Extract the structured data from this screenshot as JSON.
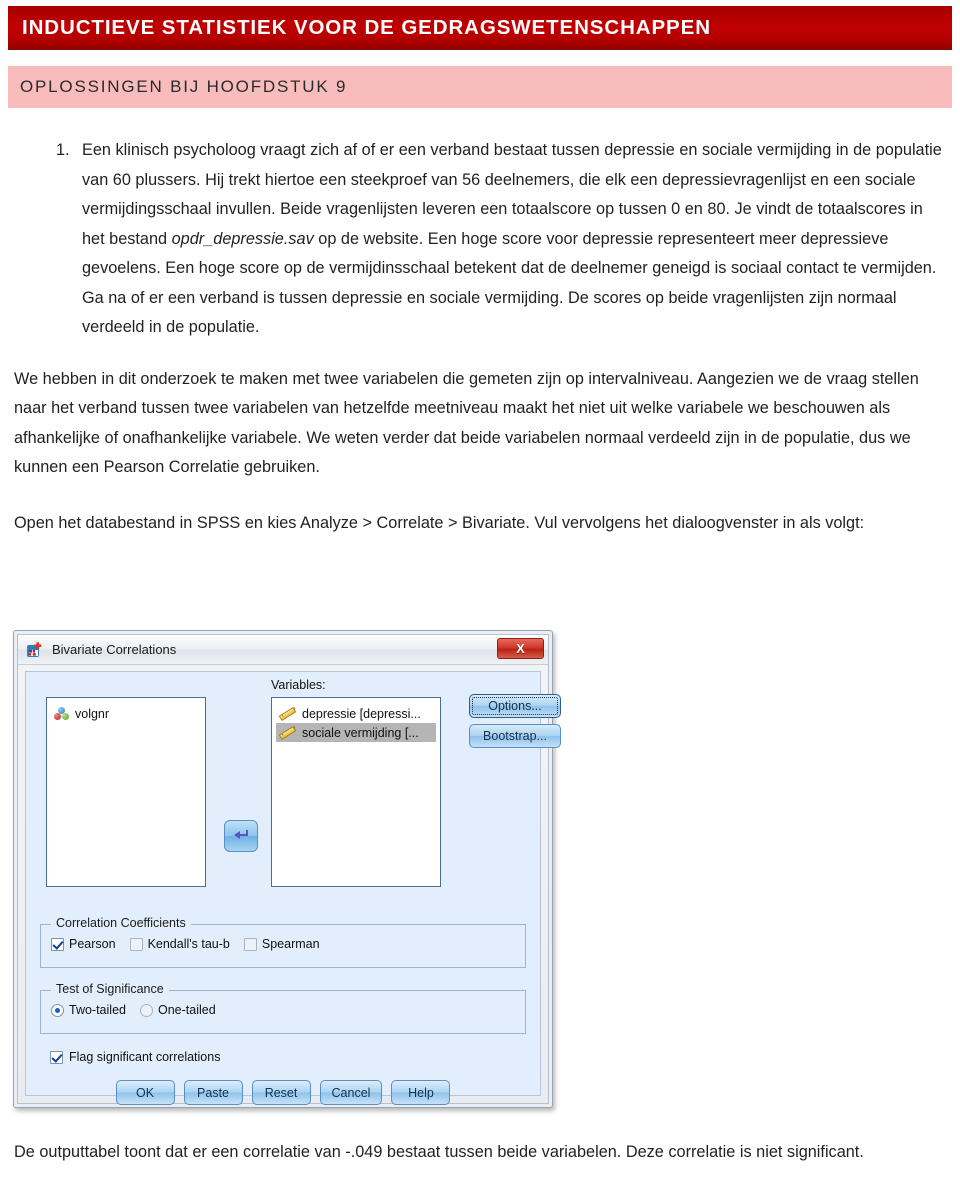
{
  "header": {
    "title": "INDUCTIEVE STATISTIEK VOOR DE GEDRAGSWETENSCHAPPEN",
    "subtitle": "OPLOSSINGEN BIJ HOOFDSTUK 9",
    "title_bg": "#b50000",
    "title_color": "#ffffff",
    "subtitle_bg": "#f9bcbc",
    "subtitle_color": "#2b2b2b"
  },
  "content": {
    "item_number": "1.",
    "paragraph_1a": "Een klinisch psycholoog vraagt zich af of er een verband bestaat tussen depressie en sociale vermijding in de populatie van 60 plussers. Hij trekt hiertoe een steekproef van 56 deelnemers, die elk een depressievragenlijst en een sociale vermijdingsschaal invullen. Beide vragenlijsten leveren een totaalscore op tussen 0 en 80. Je vindt de totaalscores in het bestand ",
    "filename": "opdr_depressie.sav",
    "paragraph_1b": " op de website. Een hoge score voor depressie representeert meer depressieve gevoelens. Een hoge score op de vermijdinsschaal betekent dat de deelnemer geneigd is sociaal contact te vermijden.",
    "paragraph_1c": "Ga na of er een verband is tussen depressie en sociale vermijding. De scores op beide vragenlijsten zijn normaal verdeeld in de populatie.",
    "paragraph_2": "We hebben in dit onderzoek te maken met twee variabelen die gemeten zijn op intervalniveau. Aangezien we de vraag stellen naar het verband tussen twee variabelen van hetzelfde meetniveau maakt het niet uit welke variabele we beschouwen als afhankelijke of onafhankelijke variabele. We weten verder dat beide variabelen normaal verdeeld zijn in de populatie, dus we kunnen een Pearson Correlatie gebruiken.",
    "paragraph_3": "Open het databestand in SPSS en kies Analyze > Correlate > Bivariate. Vul vervolgens het dialoogvenster in als volgt:",
    "paragraph_4": "De outputtabel toont dat er  een correlatie van -.049 bestaat tussen beide variabelen. Deze correlatie is niet significant."
  },
  "dialog": {
    "title": "Bivariate Correlations",
    "close_label": "X",
    "source_variables": [
      {
        "label": "volgnr",
        "icon": "nominal-icon",
        "selected": false
      }
    ],
    "variables_label": "Variables:",
    "variables": [
      {
        "label": "depressie [depressi...",
        "icon": "scale-ruler-icon",
        "selected": false
      },
      {
        "label": "sociale vermijding [...",
        "icon": "scale-ruler-icon",
        "selected": true
      }
    ],
    "move_arrow": "move-variable-arrow",
    "side_buttons": [
      {
        "label": "Options...",
        "focused": true
      },
      {
        "label": "Bootstrap...",
        "focused": false
      }
    ],
    "correlation_coefficients": {
      "title": "Correlation Coefficients",
      "options": [
        {
          "label": "Pearson",
          "checked": true
        },
        {
          "label": "Kendall's tau-b",
          "checked": false
        },
        {
          "label": "Spearman",
          "checked": false
        }
      ]
    },
    "test_of_significance": {
      "title": "Test of Significance",
      "options": [
        {
          "label": "Two-tailed",
          "selected": true
        },
        {
          "label": "One-tailed",
          "selected": false
        }
      ]
    },
    "flag_option": {
      "label": "Flag significant correlations",
      "checked": true
    },
    "buttons": [
      {
        "label": "OK"
      },
      {
        "label": "Paste"
      },
      {
        "label": "Reset"
      },
      {
        "label": "Cancel"
      },
      {
        "label": "Help"
      }
    ]
  }
}
